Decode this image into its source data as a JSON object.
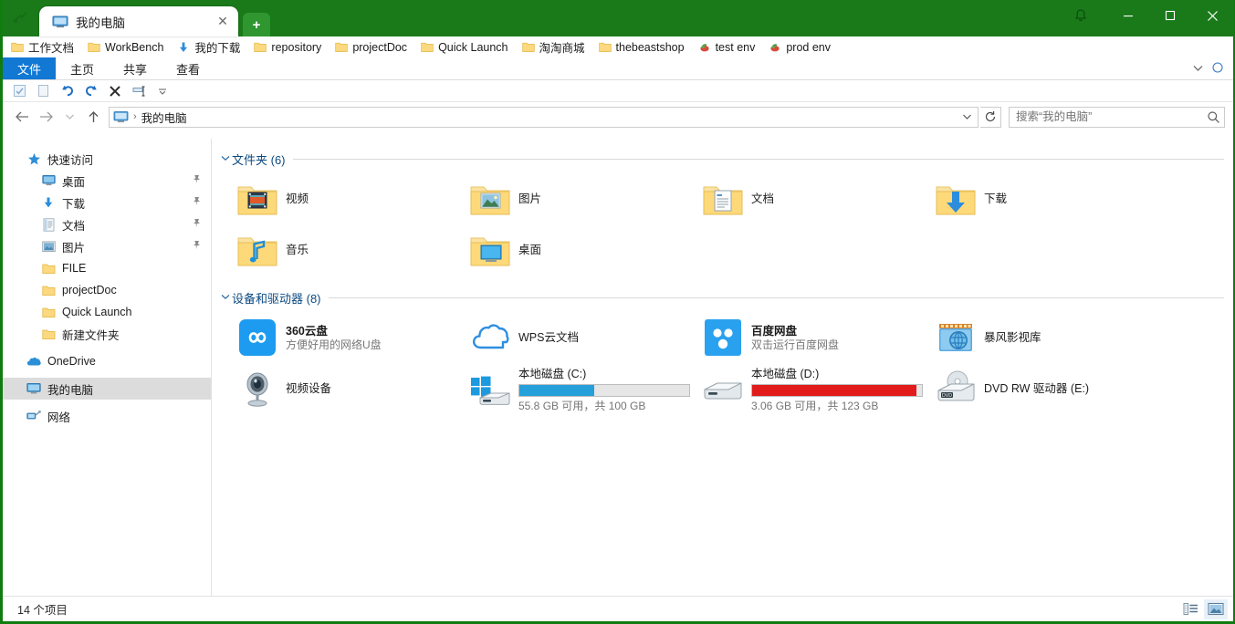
{
  "window": {
    "accent_color": "#107c10",
    "titlebar_color": "#1a7a1a",
    "app_icon": "explorer-icon",
    "notification_icon": "bell-icon",
    "minimize_label": "—",
    "maximize_label": "☐",
    "close_label": "✕"
  },
  "tabs": {
    "active": {
      "icon": "computer-icon",
      "title": "我的电脑",
      "close_label": "✕"
    },
    "new_tab_label": "+"
  },
  "bookmarks": [
    {
      "icon": "folder-icon",
      "label": "工作文档"
    },
    {
      "icon": "folder-icon",
      "label": "WorkBench"
    },
    {
      "icon": "download-arrow-icon",
      "label": "我的下载"
    },
    {
      "icon": "folder-icon",
      "label": "repository"
    },
    {
      "icon": "folder-icon",
      "label": "projectDoc"
    },
    {
      "icon": "folder-icon",
      "label": "Quick Launch"
    },
    {
      "icon": "folder-icon",
      "label": "淘淘商城"
    },
    {
      "icon": "folder-icon",
      "label": "thebeastshop"
    },
    {
      "icon": "shortcut-icon",
      "label": "test env"
    },
    {
      "icon": "shortcut-icon",
      "label": "prod env"
    }
  ],
  "ribbon": {
    "file_tab": "文件",
    "file_tab_color": "#1178d4",
    "tabs": [
      {
        "label": "主页"
      },
      {
        "label": "共享"
      },
      {
        "label": "查看"
      }
    ],
    "collapse_icon": "chevron-down-icon",
    "help_icon": "help-icon"
  },
  "quick_access": [
    {
      "icon": "properties-icon"
    },
    {
      "icon": "new-folder-icon"
    },
    {
      "icon": "undo-icon"
    },
    {
      "icon": "redo-icon"
    },
    {
      "icon": "delete-icon"
    },
    {
      "icon": "rename-icon"
    },
    {
      "icon": "chevron-down-icon"
    }
  ],
  "address": {
    "back_icon": "arrow-left-icon",
    "forward_icon": "arrow-right-icon",
    "history_icon": "chevron-down-icon",
    "up_icon": "arrow-up-icon",
    "crumb_icon": "computer-icon",
    "crumb_separator": "›",
    "crumb_text": "我的电脑",
    "dropdown_icon": "chevron-down-icon",
    "refresh_icon": "refresh-icon"
  },
  "search": {
    "placeholder": "搜索“我的电脑”",
    "value": "",
    "icon": "search-icon"
  },
  "sidebar": {
    "items": [
      {
        "label": "快速访问",
        "icon": "star-icon",
        "level": 0,
        "pin": "",
        "selected": false
      },
      {
        "label": "桌面",
        "icon": "desktop-icon",
        "level": 1,
        "pin": "📌",
        "selected": false
      },
      {
        "label": "下载",
        "icon": "download-arrow-icon",
        "level": 1,
        "pin": "📌",
        "selected": false
      },
      {
        "label": "文档",
        "icon": "document-icon",
        "level": 1,
        "pin": "📌",
        "selected": false
      },
      {
        "label": "图片",
        "icon": "picture-icon",
        "level": 1,
        "pin": "📌",
        "selected": false
      },
      {
        "label": "FILE",
        "icon": "folder-icon",
        "level": 1,
        "pin": "",
        "selected": false
      },
      {
        "label": "projectDoc",
        "icon": "folder-icon",
        "level": 1,
        "pin": "",
        "selected": false
      },
      {
        "label": "Quick Launch",
        "icon": "folder-icon",
        "level": 1,
        "pin": "",
        "selected": false
      },
      {
        "label": "新建文件夹",
        "icon": "folder-icon",
        "level": 1,
        "pin": "",
        "selected": false
      },
      {
        "label": "OneDrive",
        "icon": "onedrive-icon",
        "level": 0,
        "pin": "",
        "selected": false
      },
      {
        "label": "我的电脑",
        "icon": "computer-icon",
        "level": 0,
        "pin": "",
        "selected": true
      },
      {
        "label": "网络",
        "icon": "network-icon",
        "level": 0,
        "pin": "",
        "selected": false
      }
    ]
  },
  "content": {
    "groups": [
      {
        "chevron": "⌄",
        "title": "文件夹 (6)",
        "items": [
          {
            "icon": "folder-video-icon",
            "name": "视频",
            "sub": ""
          },
          {
            "icon": "folder-picture-icon",
            "name": "图片",
            "sub": ""
          },
          {
            "icon": "folder-document-icon",
            "name": "文档",
            "sub": ""
          },
          {
            "icon": "folder-download-icon",
            "name": "下载",
            "sub": ""
          },
          {
            "icon": "folder-music-icon",
            "name": "音乐",
            "sub": ""
          },
          {
            "icon": "folder-desktop-icon",
            "name": "桌面",
            "sub": ""
          }
        ]
      },
      {
        "chevron": "⌄",
        "title": "设备和驱动器 (8)",
        "items": [
          {
            "icon": "cloud360-icon",
            "name": "360云盘",
            "sub": "方便好用的网络U盘"
          },
          {
            "icon": "wps-cloud-icon",
            "name": "WPS云文档",
            "sub": ""
          },
          {
            "icon": "baidu-netdisk-icon",
            "name": "百度网盘",
            "sub": "双击运行百度网盘"
          },
          {
            "icon": "baofeng-icon",
            "name": "暴风影视库",
            "sub": ""
          },
          {
            "icon": "camera-icon",
            "name": "视频设备",
            "sub": ""
          },
          {
            "icon": "windows-drive-icon",
            "name": "本地磁盘 (C:)",
            "capacity": "55.8 GB 可用，共 100 GB",
            "used_percent": 44,
            "bar_color": "#26a0da",
            "is_drive": true
          },
          {
            "icon": "hdd-icon",
            "name": "本地磁盘 (D:)",
            "capacity": "3.06 GB 可用，共 123 GB",
            "used_percent": 97,
            "bar_color": "#e21b1b",
            "is_drive": true
          },
          {
            "icon": "dvd-icon",
            "name": "DVD RW 驱动器 (E:)",
            "sub": ""
          }
        ]
      }
    ]
  },
  "statusbar": {
    "item_count": "14 个项目",
    "view_details_icon": "details-view-icon",
    "view_large_icon": "large-icons-view-icon"
  }
}
